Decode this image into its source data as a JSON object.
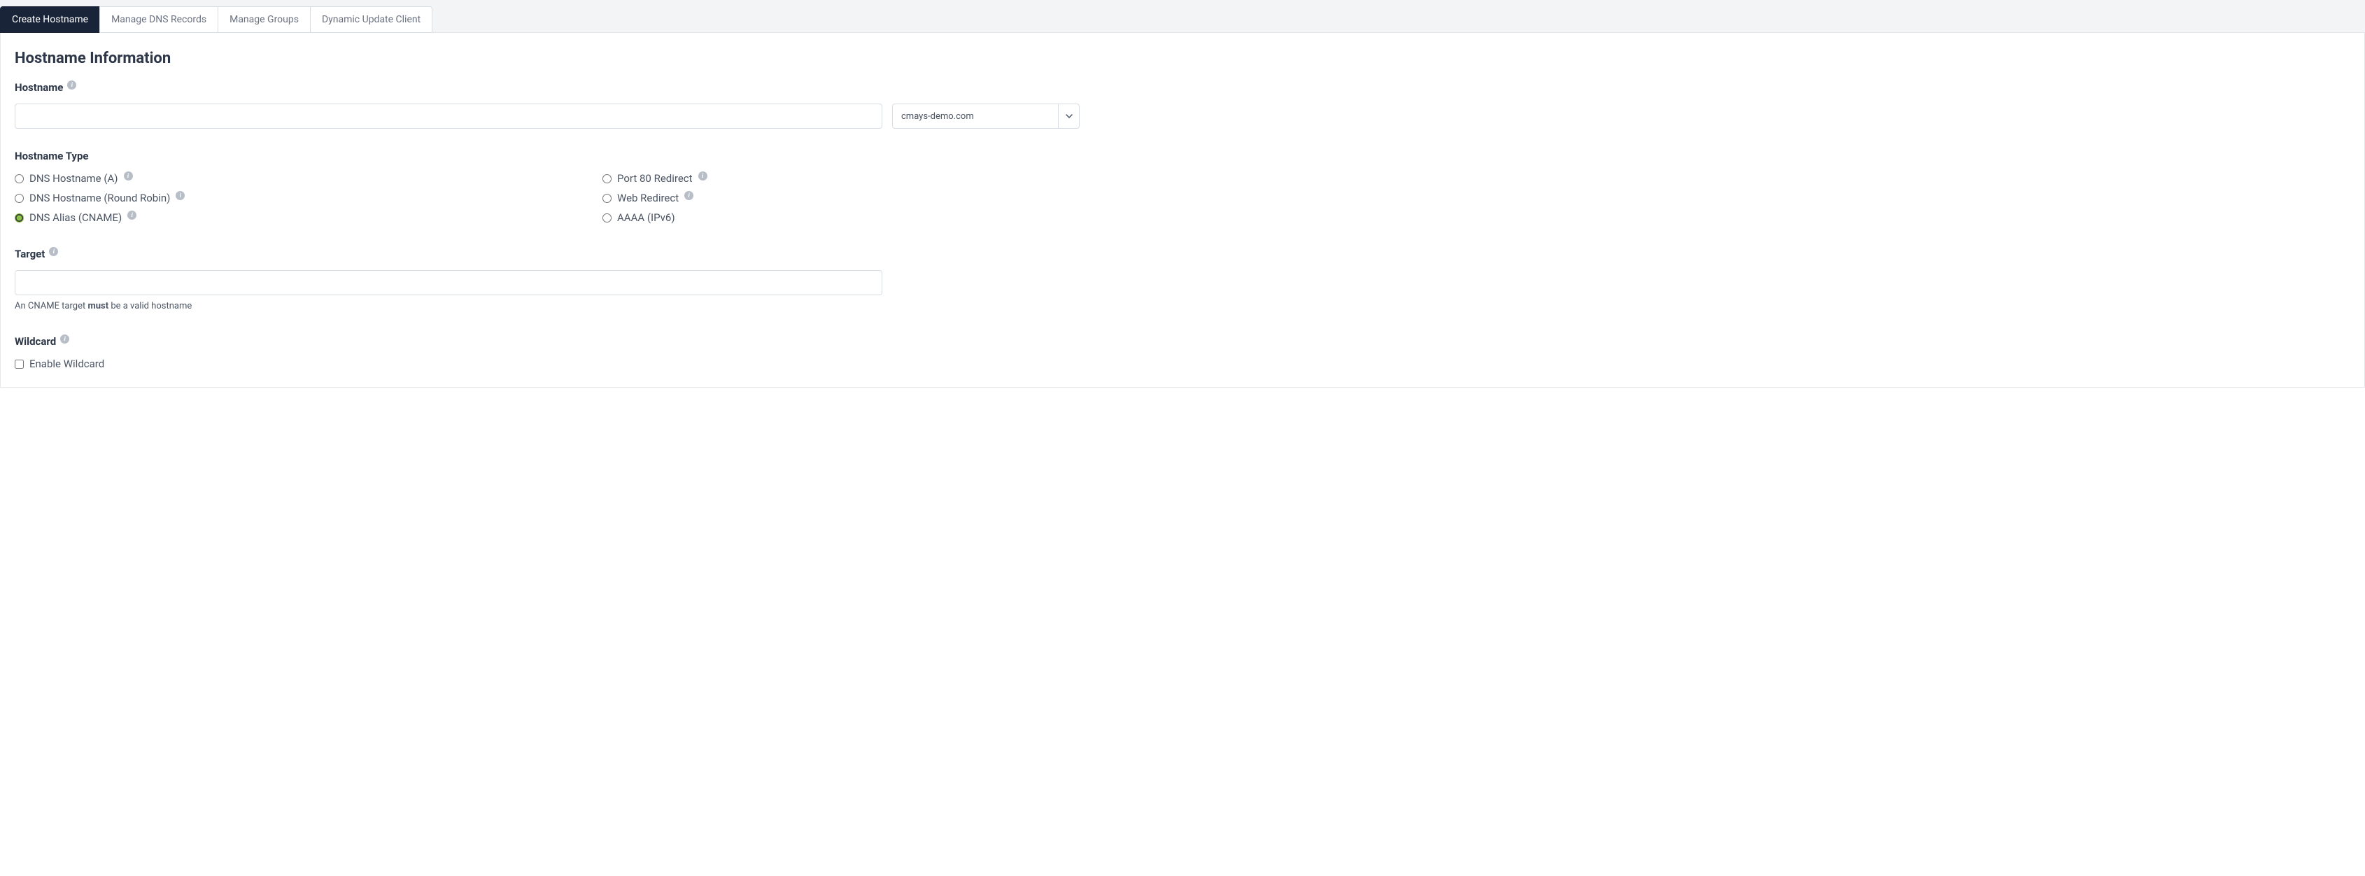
{
  "tabs": [
    {
      "label": "Create Hostname",
      "active": true
    },
    {
      "label": "Manage DNS Records",
      "active": false
    },
    {
      "label": "Manage Groups",
      "active": false
    },
    {
      "label": "Dynamic Update Client",
      "active": false
    }
  ],
  "heading": "Hostname Information",
  "hostname": {
    "label": "Hostname",
    "value": "",
    "domain_selected": "cmays-demo.com"
  },
  "hostname_type": {
    "label": "Hostname Type",
    "options_left": [
      {
        "label": "DNS Hostname (A)",
        "checked": false,
        "info": true
      },
      {
        "label": "DNS Hostname (Round Robin)",
        "checked": false,
        "info": true
      },
      {
        "label": "DNS Alias (CNAME)",
        "checked": true,
        "info": true
      }
    ],
    "options_right": [
      {
        "label": "Port 80 Redirect",
        "checked": false,
        "info": true
      },
      {
        "label": "Web Redirect",
        "checked": false,
        "info": true
      },
      {
        "label": "AAAA (IPv6)",
        "checked": false,
        "info": false
      }
    ]
  },
  "target": {
    "label": "Target",
    "value": "",
    "help_prefix": "An CNAME target ",
    "help_bold": "must",
    "help_suffix": " be a valid hostname"
  },
  "wildcard": {
    "label": "Wildcard",
    "checkbox_label": "Enable Wildcard",
    "checked": false
  }
}
